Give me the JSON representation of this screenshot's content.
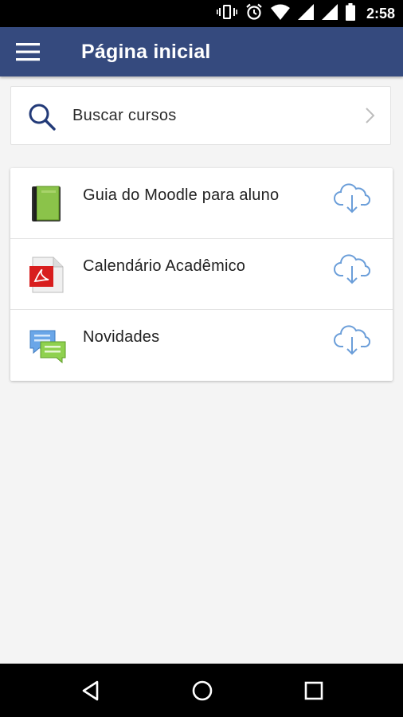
{
  "status_bar": {
    "time": "2:58",
    "icons": [
      "vibrate-icon",
      "alarm-icon",
      "wifi-icon",
      "signal-icon",
      "signal-icon-2",
      "battery-icon"
    ]
  },
  "header": {
    "title": "Página inicial",
    "menu_icon": "hamburger-menu-icon",
    "color": "#354a7e"
  },
  "search": {
    "label": "Buscar cursos",
    "icon": "search-icon",
    "chevron_icon": "chevron-right-icon"
  },
  "items": [
    {
      "label": "Guia do Moodle para aluno",
      "icon": "book-icon",
      "action_icon": "cloud-download-icon"
    },
    {
      "label": "Calendário Acadêmico",
      "icon": "pdf-icon",
      "action_icon": "cloud-download-icon"
    },
    {
      "label": "Novidades",
      "icon": "forum-icon",
      "action_icon": "cloud-download-icon"
    }
  ],
  "nav_bar": {
    "buttons": [
      "back-icon",
      "home-icon",
      "recents-icon"
    ]
  },
  "colors": {
    "accent": "#354a7e",
    "download": "#6b9ed9",
    "background": "#f4f4f4"
  }
}
